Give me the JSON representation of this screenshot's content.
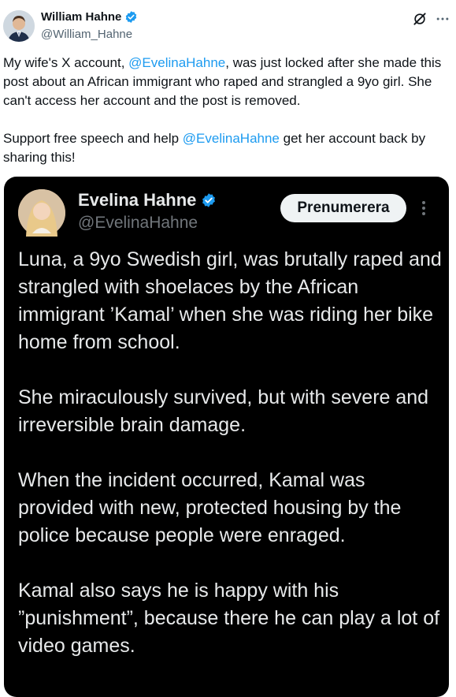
{
  "author": {
    "display_name": "William Hahne",
    "handle": "@William_Hahne",
    "avatar_icon": "avatar-man-suit",
    "verified_icon": "verified-badge-icon"
  },
  "header_icons": {
    "grok": "grok-icon",
    "more": "more-horizontal-icon"
  },
  "tweet": {
    "segments": [
      {
        "text": "My wife's X account, ",
        "type": "text"
      },
      {
        "text": "@EvelinaHahne",
        "type": "mention"
      },
      {
        "text": ", was just locked after she made this post about an African immigrant who raped and strangled a 9yo girl. She can't access her account and the post is removed.\n\nSupport free speech and help ",
        "type": "text"
      },
      {
        "text": "@EvelinaHahne",
        "type": "mention"
      },
      {
        "text": " get her account back by sharing this!",
        "type": "text"
      }
    ]
  },
  "embedded": {
    "display_name": "Evelina Hahne",
    "handle": "@EvelinaHahne",
    "subscribe_label": "Prenumerera",
    "paragraphs": [
      "Luna, a 9yo Swedish girl, was brutally raped and strangled with shoelaces by the African immigrant ’Kamal’ when she was riding her bike home from school.",
      "She miraculously survived, but with severe and irreversible brain damage.",
      "When the incident occurred, Kamal was provided with new, protected housing by the police because people were enraged.",
      "Kamal also says he is happy with his ”punishment”, because there he can play a lot of video games."
    ]
  },
  "colors": {
    "accent": "#1d9bf0",
    "text": "#0f1419",
    "secondary": "#536471",
    "embed_bg": "#000000"
  }
}
